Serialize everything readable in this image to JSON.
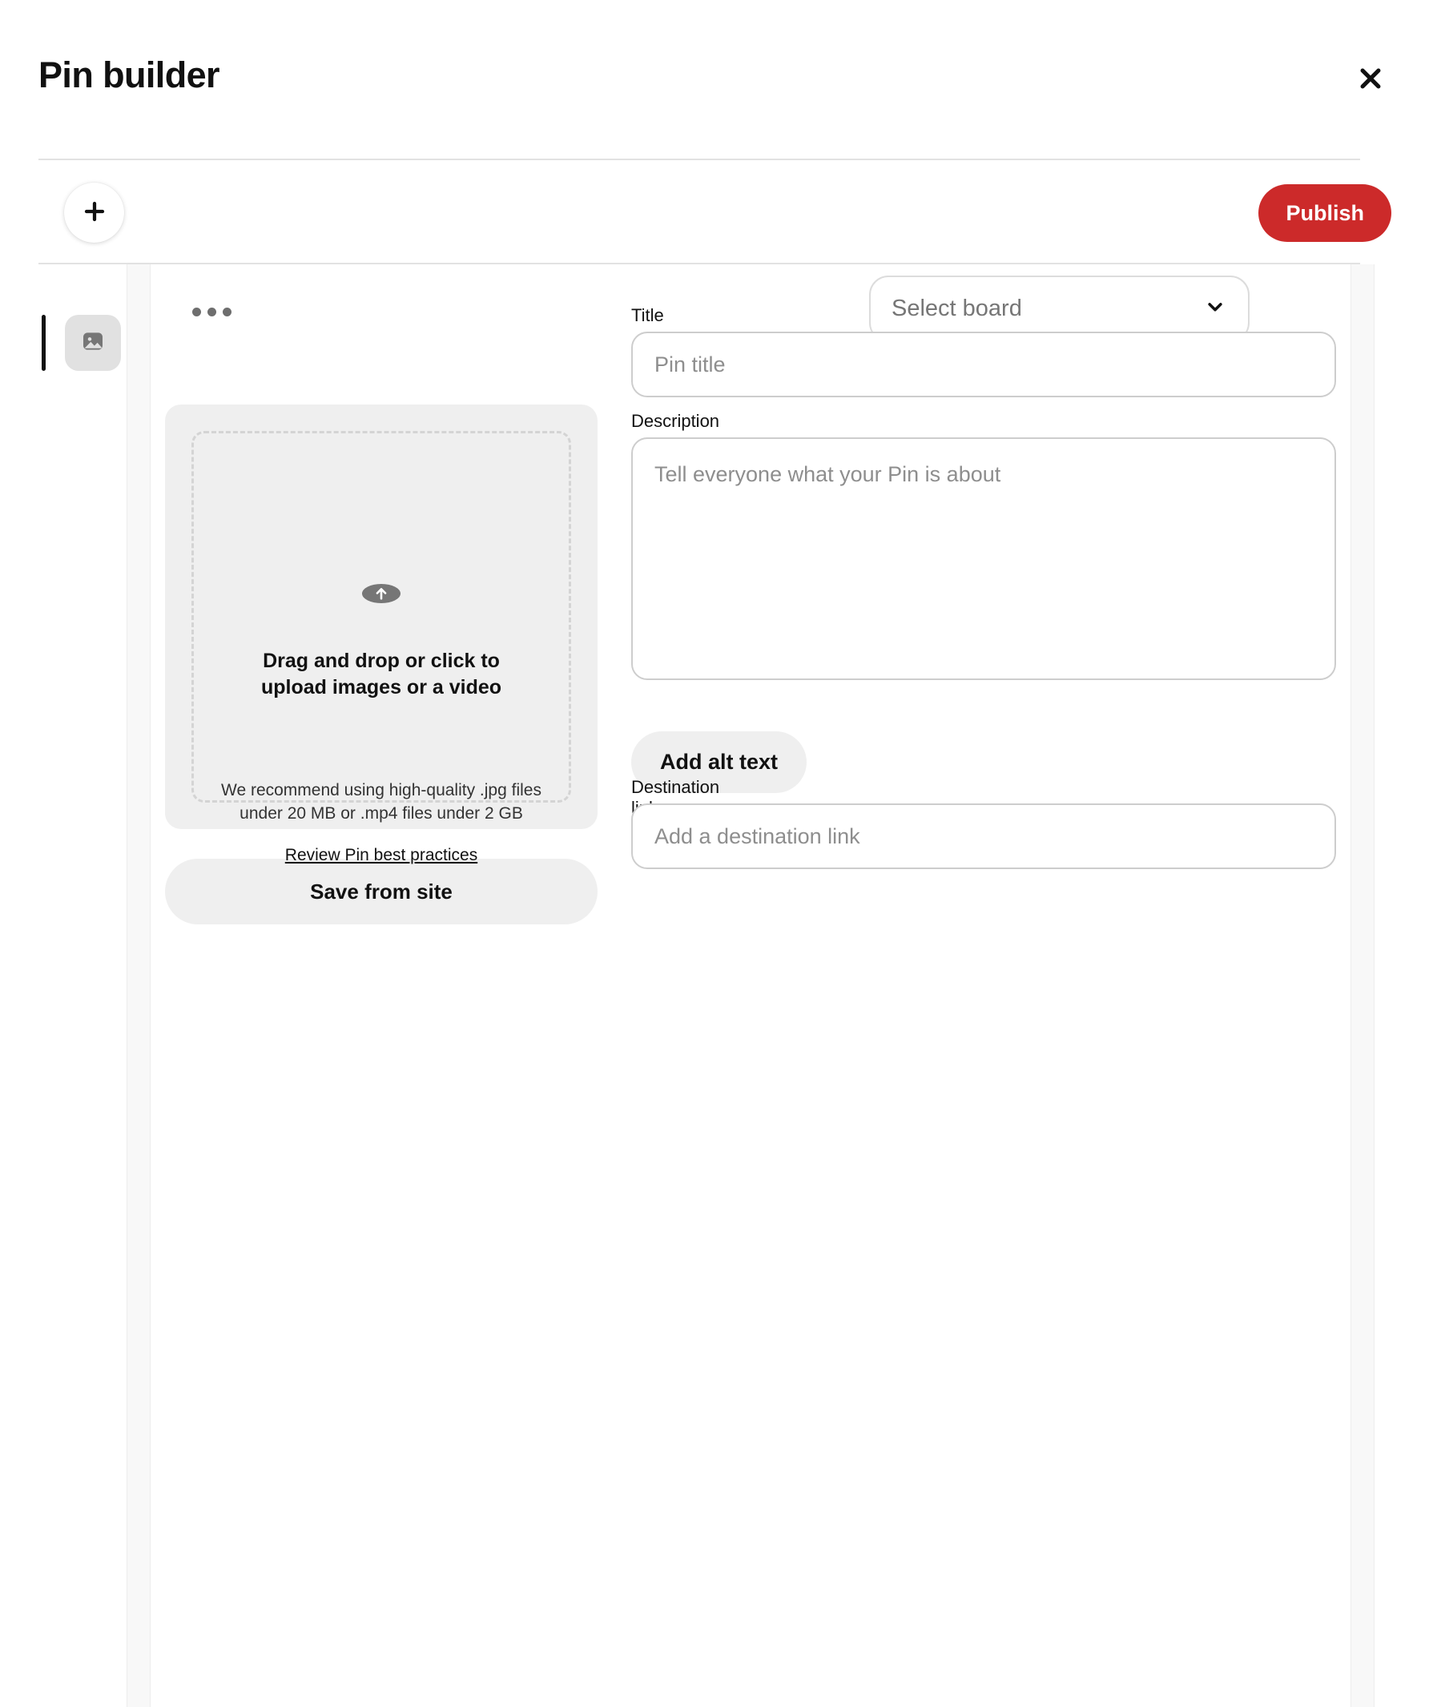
{
  "header": {
    "title": "Pin builder",
    "close_icon": "close-icon"
  },
  "toolbar": {
    "add_icon": "plus-icon",
    "publish_label": "Publish"
  },
  "rail": {
    "items": [
      {
        "icon": "image-icon",
        "selected": true
      }
    ]
  },
  "panel": {
    "kebab_icon": "ellipsis-icon"
  },
  "media": {
    "upload_icon": "upload-arrow-icon",
    "headline": "Drag and drop or click to upload images or a video",
    "recommendation": "We recommend using high-quality .jpg files under 20 MB or .mp4 files under 2 GB",
    "best_practices_link": "Review Pin best practices",
    "save_from_site_label": "Save from site"
  },
  "form": {
    "board": {
      "selected_label": "Select board",
      "chevron_icon": "chevron-down-icon"
    },
    "title": {
      "label": "Title",
      "placeholder": "Pin title",
      "value": ""
    },
    "description": {
      "label": "Description",
      "placeholder": "Tell everyone what your Pin is about",
      "value": ""
    },
    "alt_text_label": "Add alt text",
    "destination": {
      "label": "Destination link",
      "placeholder": "Add a destination link",
      "value": ""
    }
  },
  "colors": {
    "brand_red": "#cc2a2a",
    "surface_gray": "#efefef",
    "border_gray": "#cdcdcd",
    "text_primary": "#111111",
    "text_muted": "#767676"
  }
}
